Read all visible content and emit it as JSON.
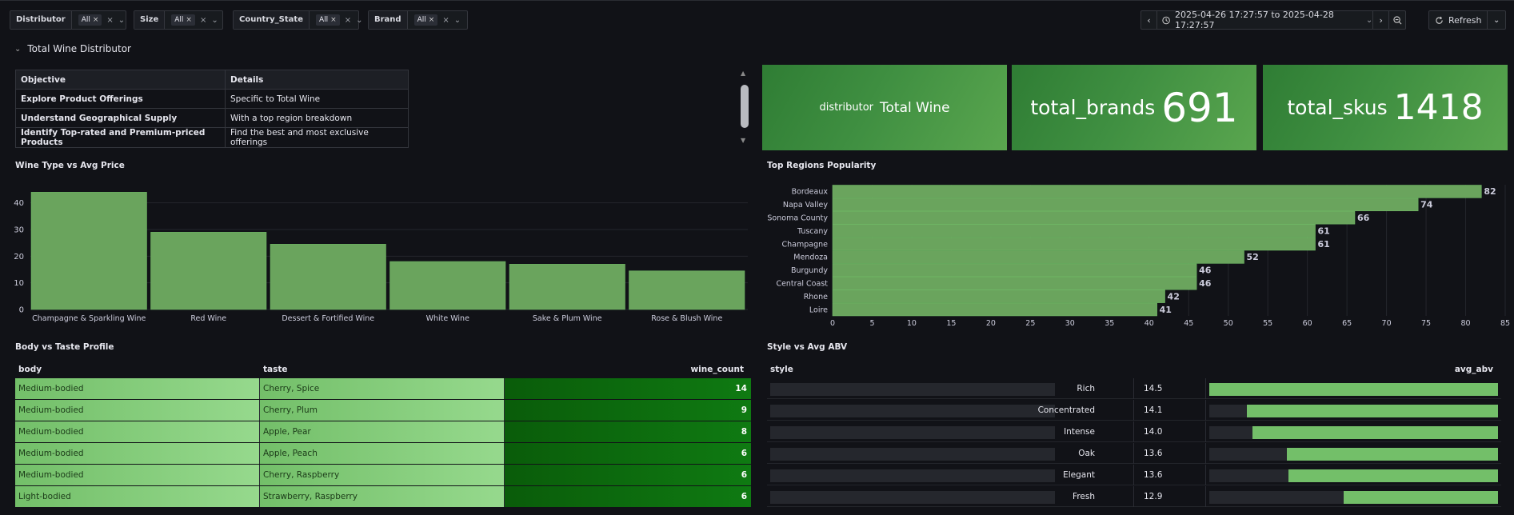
{
  "filters": [
    {
      "label": "Distributor",
      "value": "All"
    },
    {
      "label": "Size",
      "value": "All"
    },
    {
      "label": "Country_State",
      "value": "All"
    },
    {
      "label": "Brand",
      "value": "All"
    }
  ],
  "time_range": {
    "text": "2025-04-26 17:27:57 to 2025-04-28 17:27:57",
    "refresh_label": "Refresh"
  },
  "section": {
    "title": "Total Wine Distributor"
  },
  "objective_table": {
    "headers": [
      "Objective",
      "Details"
    ],
    "rows": [
      [
        "Explore Product Offerings",
        "Specific to Total Wine"
      ],
      [
        "Understand Geographical Supply",
        "With a top region breakdown"
      ],
      [
        "Identify Top-rated and Premium-priced Products",
        "Find the best and most exclusive offerings"
      ]
    ]
  },
  "stats": [
    {
      "label": "distributor",
      "value": "Total Wine"
    },
    {
      "label": "total_brands",
      "value": "691"
    },
    {
      "label": "total_skus",
      "value": "1418"
    }
  ],
  "colors": {
    "bar_green": "#73bf69",
    "dark_green": "#0f7a12",
    "stat_green": "#3f8f41",
    "bg": "#111217"
  },
  "chart_data": [
    {
      "type": "bar",
      "title": "Wine Type vs Avg Price",
      "categories": [
        "Champagne & Sparkling Wine",
        "Red Wine",
        "Dessert & Fortified Wine",
        "White Wine",
        "Sake & Plum Wine",
        "Rose & Blush Wine"
      ],
      "values": [
        44,
        29,
        24.5,
        18,
        17,
        14.5
      ],
      "ylim": [
        0,
        45
      ],
      "yticks": [
        0,
        10,
        20,
        30,
        40
      ],
      "grid": true
    },
    {
      "type": "bar",
      "orientation": "horizontal",
      "title": "Top Regions Popularity",
      "categories": [
        "Bordeaux",
        "Napa Valley",
        "Sonoma County",
        "Tuscany",
        "Champagne",
        "Mendoza",
        "Burgundy",
        "Central Coast",
        "Rhone",
        "Loire"
      ],
      "values": [
        82,
        74,
        66,
        61,
        61,
        52,
        46,
        46,
        42,
        41
      ],
      "xlim": [
        0,
        85
      ],
      "xticks": [
        0,
        5,
        10,
        15,
        20,
        25,
        30,
        35,
        40,
        45,
        50,
        55,
        60,
        65,
        70,
        75,
        80,
        85
      ],
      "grid": true
    },
    {
      "type": "table",
      "title": "Body vs Taste Profile",
      "columns": [
        "body",
        "taste",
        "wine_count"
      ],
      "rows": [
        [
          "Medium-bodied",
          "Cherry, Spice",
          "14"
        ],
        [
          "Medium-bodied",
          "Cherry, Plum",
          "9"
        ],
        [
          "Medium-bodied",
          "Apple, Pear",
          "8"
        ],
        [
          "Medium-bodied",
          "Apple, Peach",
          "6"
        ],
        [
          "Medium-bodied",
          "Cherry, Raspberry",
          "6"
        ],
        [
          "Light-bodied",
          "Strawberry, Raspberry",
          "6"
        ]
      ]
    },
    {
      "type": "table",
      "title": "Style vs Avg ABV",
      "columns": [
        "style",
        "avg_abv"
      ],
      "rows": [
        [
          "Rich",
          "14.5"
        ],
        [
          "Concentrated",
          "14.1"
        ],
        [
          "Intense",
          "14.0"
        ],
        [
          "Oak",
          "13.6"
        ],
        [
          "Elegant",
          "13.6"
        ],
        [
          "Fresh",
          "12.9"
        ]
      ],
      "gauge_fraction": [
        1.0,
        0.87,
        0.85,
        0.73,
        0.725,
        0.535
      ]
    }
  ]
}
